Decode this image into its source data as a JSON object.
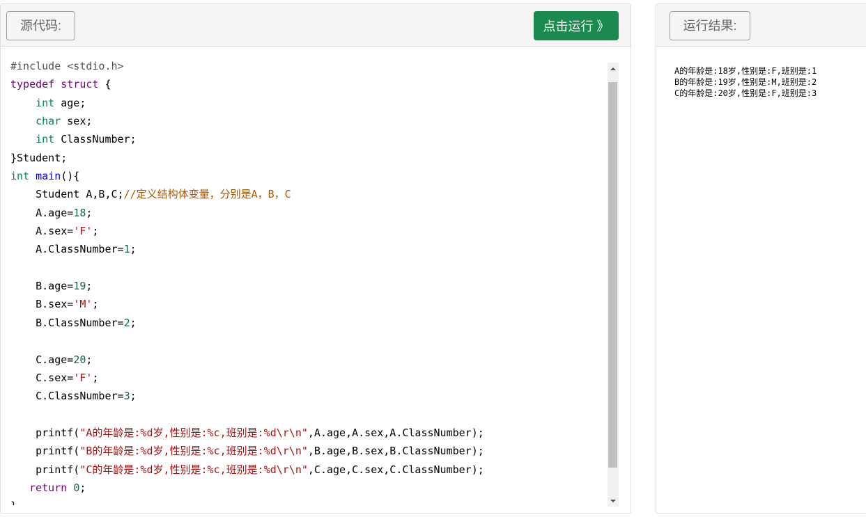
{
  "source_panel": {
    "label": "源代码:",
    "run_button_label": "点击运行 》"
  },
  "result_panel": {
    "label": "运行结果:"
  },
  "code_lines": [
    [
      {
        "c": "meta",
        "t": "#include <stdio.h>"
      }
    ],
    [
      {
        "c": "kw",
        "t": "typedef struct"
      },
      {
        "c": "plain",
        "t": " {"
      }
    ],
    [
      {
        "c": "plain",
        "t": "    "
      },
      {
        "c": "type",
        "t": "int"
      },
      {
        "c": "plain",
        "t": " age;"
      }
    ],
    [
      {
        "c": "plain",
        "t": "    "
      },
      {
        "c": "type",
        "t": "char"
      },
      {
        "c": "plain",
        "t": " sex;"
      }
    ],
    [
      {
        "c": "plain",
        "t": "    "
      },
      {
        "c": "type",
        "t": "int"
      },
      {
        "c": "plain",
        "t": " ClassNumber;"
      }
    ],
    [
      {
        "c": "plain",
        "t": "}Student;"
      }
    ],
    [
      {
        "c": "type",
        "t": "int"
      },
      {
        "c": "plain",
        "t": " "
      },
      {
        "c": "def",
        "t": "main"
      },
      {
        "c": "plain",
        "t": "(){"
      }
    ],
    [
      {
        "c": "plain",
        "t": "    Student A,B,C;"
      },
      {
        "c": "cmt",
        "t": "//定义结构体变量，分别是A，B，C"
      }
    ],
    [
      {
        "c": "plain",
        "t": "    A.age="
      },
      {
        "c": "num",
        "t": "18"
      },
      {
        "c": "plain",
        "t": ";"
      }
    ],
    [
      {
        "c": "plain",
        "t": "    A.sex="
      },
      {
        "c": "str",
        "t": "'F'"
      },
      {
        "c": "plain",
        "t": ";"
      }
    ],
    [
      {
        "c": "plain",
        "t": "    A.ClassNumber="
      },
      {
        "c": "num",
        "t": "1"
      },
      {
        "c": "plain",
        "t": ";"
      }
    ],
    [
      {
        "c": "plain",
        "t": ""
      }
    ],
    [
      {
        "c": "plain",
        "t": "    B.age="
      },
      {
        "c": "num",
        "t": "19"
      },
      {
        "c": "plain",
        "t": ";"
      }
    ],
    [
      {
        "c": "plain",
        "t": "    B.sex="
      },
      {
        "c": "str",
        "t": "'M'"
      },
      {
        "c": "plain",
        "t": ";"
      }
    ],
    [
      {
        "c": "plain",
        "t": "    B.ClassNumber="
      },
      {
        "c": "num",
        "t": "2"
      },
      {
        "c": "plain",
        "t": ";"
      }
    ],
    [
      {
        "c": "plain",
        "t": ""
      }
    ],
    [
      {
        "c": "plain",
        "t": "    C.age="
      },
      {
        "c": "num",
        "t": "20"
      },
      {
        "c": "plain",
        "t": ";"
      }
    ],
    [
      {
        "c": "plain",
        "t": "    C.sex="
      },
      {
        "c": "str",
        "t": "'F'"
      },
      {
        "c": "plain",
        "t": ";"
      }
    ],
    [
      {
        "c": "plain",
        "t": "    C.ClassNumber="
      },
      {
        "c": "num",
        "t": "3"
      },
      {
        "c": "plain",
        "t": ";"
      }
    ],
    [
      {
        "c": "plain",
        "t": ""
      }
    ],
    [
      {
        "c": "plain",
        "t": "    printf("
      },
      {
        "c": "str",
        "t": "\"A的年龄是:%d岁,性别是:%c,班别是:%d\\r\\n\""
      },
      {
        "c": "plain",
        "t": ",A.age,A.sex,A.ClassNumber);"
      }
    ],
    [
      {
        "c": "plain",
        "t": "    printf("
      },
      {
        "c": "str",
        "t": "\"B的年龄是:%d岁,性别是:%c,班别是:%d\\r\\n\""
      },
      {
        "c": "plain",
        "t": ",B.age,B.sex,B.ClassNumber);"
      }
    ],
    [
      {
        "c": "plain",
        "t": "    printf("
      },
      {
        "c": "str",
        "t": "\"C的年龄是:%d岁,性别是:%c,班别是:%d\\r\\n\""
      },
      {
        "c": "plain",
        "t": ",C.age,C.sex,C.ClassNumber);"
      }
    ],
    [
      {
        "c": "plain",
        "t": "   "
      },
      {
        "c": "kw",
        "t": "return"
      },
      {
        "c": "plain",
        "t": " "
      },
      {
        "c": "num",
        "t": "0"
      },
      {
        "c": "plain",
        "t": ";"
      }
    ],
    [
      {
        "c": "plain",
        "t": "}"
      }
    ]
  ],
  "output": "A的年龄是:18岁,性别是:F,班别是:1\nB的年龄是:19岁,性别是:M,班别是:2\nC的年龄是:20岁,性别是:F,班别是:3",
  "colors": {
    "run_button": "#1a8a4f",
    "keyword": "#770088",
    "type": "#008855",
    "function": "#0000ff",
    "number": "#116644",
    "string": "#aa1111",
    "comment": "#aa5500"
  }
}
